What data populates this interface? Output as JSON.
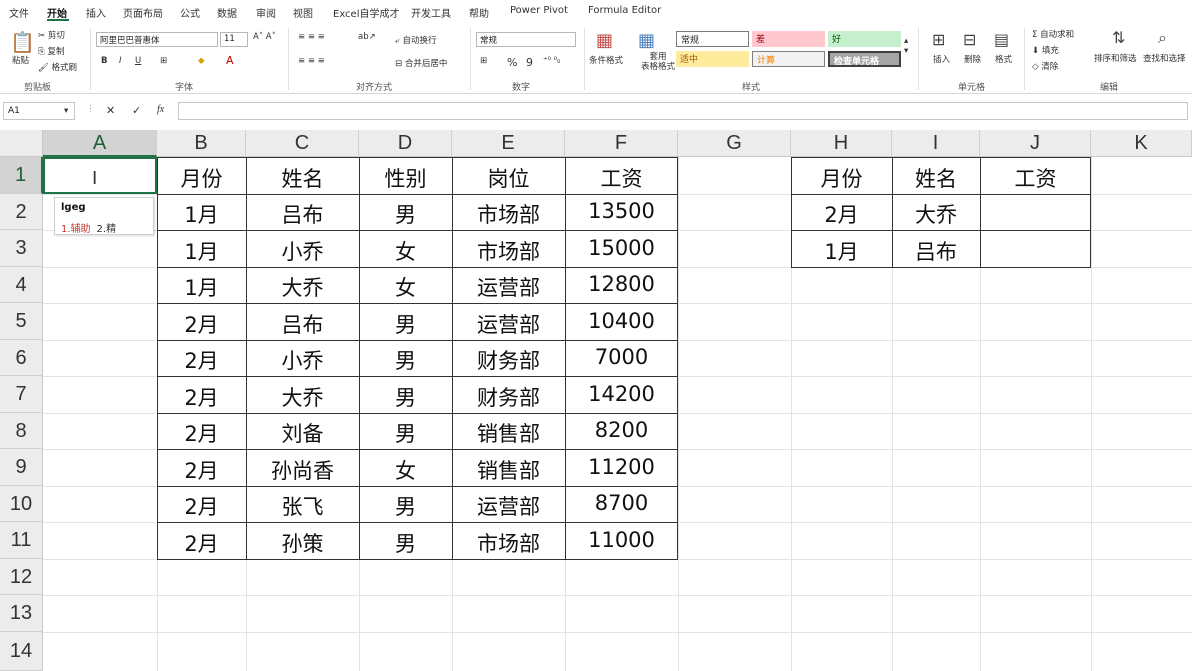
{
  "ribbon_tabs": [
    "文件",
    "开始",
    "插入",
    "页面布局",
    "公式",
    "数据",
    "审阅",
    "视图",
    "Excel自学成才",
    "开发工具",
    "帮助",
    "Power Pivot",
    "Formula Editor"
  ],
  "ribbon": {
    "clipboard": {
      "paste": "粘贴",
      "cut": "剪切",
      "copy": "复制",
      "format_painter": "格式刷",
      "label": "剪贴板"
    },
    "font": {
      "name": "阿里巴巴普惠体",
      "size": "11",
      "bold": "B",
      "italic": "I",
      "underline": "U",
      "label": "字体"
    },
    "alignment": {
      "wrap": "自动换行",
      "merge": "合并后居中",
      "label": "对齐方式"
    },
    "number": {
      "format": "常规",
      "percent": "%",
      "comma": "9",
      "label": "数字"
    },
    "styles": {
      "conditional": "条件格式",
      "table": "套用\n表格格式",
      "normal": "常规",
      "bad": "差",
      "good": "好",
      "neutral": "适中",
      "calc": "计算",
      "check": "检查单元格",
      "label": "样式"
    },
    "cells": {
      "insert": "插入",
      "delete": "删除",
      "format": "格式",
      "label": "单元格"
    },
    "editing": {
      "autosum": "自动求和",
      "fill": "填充",
      "clear": "清除",
      "sort": "排序和筛选",
      "find": "查找和选择",
      "label": "编辑"
    }
  },
  "formula_bar": {
    "name_box": "A1",
    "fx": "fx",
    "content": ""
  },
  "columns": [
    "A",
    "B",
    "C",
    "D",
    "E",
    "F",
    "G",
    "H",
    "I",
    "J",
    "K"
  ],
  "rows": [
    "1",
    "2",
    "3",
    "4",
    "5",
    "6",
    "7",
    "8",
    "9",
    "10",
    "11",
    "12",
    "13",
    "14"
  ],
  "main_table": {
    "headers": [
      "月份",
      "姓名",
      "性别",
      "岗位",
      "工资"
    ],
    "rows": [
      [
        "1月",
        "吕布",
        "男",
        "市场部",
        "13500"
      ],
      [
        "1月",
        "小乔",
        "女",
        "市场部",
        "15000"
      ],
      [
        "1月",
        "大乔",
        "女",
        "运营部",
        "12800"
      ],
      [
        "2月",
        "吕布",
        "男",
        "运营部",
        "10400"
      ],
      [
        "2月",
        "小乔",
        "男",
        "财务部",
        "7000"
      ],
      [
        "2月",
        "大乔",
        "男",
        "财务部",
        "14200"
      ],
      [
        "2月",
        "刘备",
        "男",
        "销售部",
        "8200"
      ],
      [
        "2月",
        "孙尚香",
        "女",
        "销售部",
        "11200"
      ],
      [
        "2月",
        "张飞",
        "男",
        "运营部",
        "8700"
      ],
      [
        "2月",
        "孙策",
        "男",
        "市场部",
        "11000"
      ]
    ]
  },
  "lookup_table": {
    "headers": [
      "月份",
      "姓名",
      "工资"
    ],
    "rows": [
      [
        "2月",
        "大乔",
        ""
      ],
      [
        "1月",
        "吕布",
        ""
      ]
    ]
  },
  "ime": {
    "composition": "lgeg",
    "candidate1": "1.辅助",
    "candidate2": "2.精"
  },
  "colors": {
    "accent": "#217346",
    "header_bg": "#ececec"
  }
}
